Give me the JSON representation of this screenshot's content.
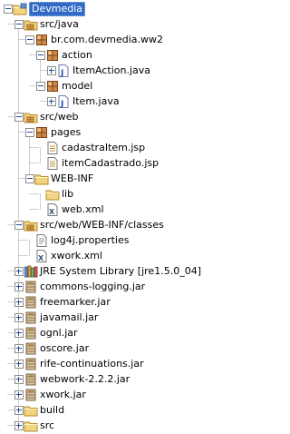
{
  "tree": {
    "nodes": [
      {
        "depth": 0,
        "label": "Devmedia",
        "icon": "project-icon",
        "expander": "open",
        "selected": true
      },
      {
        "depth": 1,
        "label": "src/java",
        "icon": "source-folder-icon",
        "expander": "open"
      },
      {
        "depth": 2,
        "label": "br.com.devmedia.ww2",
        "icon": "package-icon",
        "expander": "open"
      },
      {
        "depth": 3,
        "label": "action",
        "icon": "package-icon",
        "expander": "open"
      },
      {
        "depth": 4,
        "label": "ItemAction.java",
        "icon": "java-file-icon",
        "expander": "closed"
      },
      {
        "depth": 3,
        "label": "model",
        "icon": "package-icon",
        "expander": "open"
      },
      {
        "depth": 4,
        "label": "Item.java",
        "icon": "java-file-icon",
        "expander": "closed"
      },
      {
        "depth": 1,
        "label": "src/web",
        "icon": "source-folder-icon",
        "expander": "open"
      },
      {
        "depth": 2,
        "label": "pages",
        "icon": "package-icon",
        "expander": "open"
      },
      {
        "depth": 3,
        "label": "cadastraItem.jsp",
        "icon": "jsp-file-icon",
        "expander": "none"
      },
      {
        "depth": 3,
        "label": "itemCadastrado.jsp",
        "icon": "jsp-file-icon",
        "expander": "none"
      },
      {
        "depth": 2,
        "label": "WEB-INF",
        "icon": "folder-icon",
        "expander": "open"
      },
      {
        "depth": 3,
        "label": "lib",
        "icon": "folder-icon",
        "expander": "none"
      },
      {
        "depth": 3,
        "label": "web.xml",
        "icon": "xml-file-icon",
        "expander": "none"
      },
      {
        "depth": 1,
        "label": "src/web/WEB-INF/classes",
        "icon": "source-folder-icon",
        "expander": "open"
      },
      {
        "depth": 2,
        "label": "log4j.properties",
        "icon": "properties-file-icon",
        "expander": "none"
      },
      {
        "depth": 2,
        "label": "xwork.xml",
        "icon": "xml-file-icon",
        "expander": "none"
      },
      {
        "depth": 1,
        "label": "JRE System Library [jre1.5.0_04]",
        "icon": "library-icon",
        "expander": "closed"
      },
      {
        "depth": 1,
        "label": "commons-logging.jar",
        "icon": "jar-icon",
        "expander": "closed"
      },
      {
        "depth": 1,
        "label": "freemarker.jar",
        "icon": "jar-icon",
        "expander": "closed"
      },
      {
        "depth": 1,
        "label": "javamail.jar",
        "icon": "jar-icon",
        "expander": "closed"
      },
      {
        "depth": 1,
        "label": "ognl.jar",
        "icon": "jar-icon",
        "expander": "closed"
      },
      {
        "depth": 1,
        "label": "oscore.jar",
        "icon": "jar-icon",
        "expander": "closed"
      },
      {
        "depth": 1,
        "label": "rife-continuations.jar",
        "icon": "jar-icon",
        "expander": "closed"
      },
      {
        "depth": 1,
        "label": "webwork-2.2.2.jar",
        "icon": "jar-icon",
        "expander": "closed"
      },
      {
        "depth": 1,
        "label": "xwork.jar",
        "icon": "jar-icon",
        "expander": "closed"
      },
      {
        "depth": 1,
        "label": "build",
        "icon": "folder-icon",
        "expander": "closed"
      },
      {
        "depth": 1,
        "label": "src",
        "icon": "folder-icon",
        "expander": "closed"
      }
    ]
  },
  "colors": {
    "selection": "#316ac5",
    "folder": "#f3d480",
    "package": "#c0703a",
    "jar": "#a0826a",
    "guide": "#a0a0a0"
  }
}
